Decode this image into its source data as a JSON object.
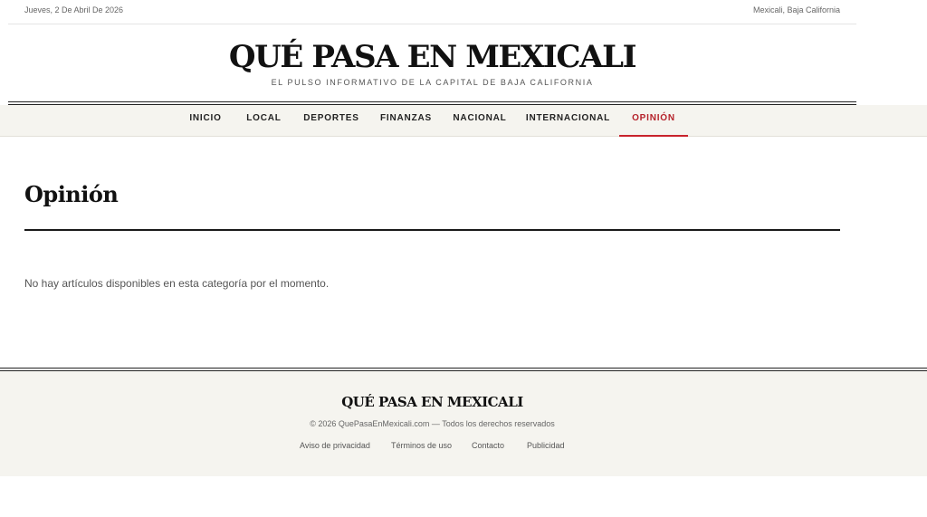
{
  "topbar": {
    "date": "Jueves, 2 De Abril De 2026",
    "location": "Mexicali, Baja California"
  },
  "masthead": {
    "title": "QUÉ PASA EN MEXICALI",
    "tagline": "EL PULSO INFORMATIVO DE LA CAPITAL DE BAJA CALIFORNIA"
  },
  "nav": {
    "items": [
      "INICIO",
      "LOCAL",
      "DEPORTES",
      "FINANZAS",
      "NACIONAL",
      "INTERNACIONAL",
      "OPINIÓN"
    ],
    "active": "OPINIÓN"
  },
  "main": {
    "heading": "Opinión",
    "empty_message": "No hay artículos disponibles en esta categoría por el momento."
  },
  "footer": {
    "title": "QUÉ PASA EN MEXICALI",
    "copyright": "© 2026 QuePasaEnMexicali.com — Todos los derechos reservados",
    "links": [
      "Aviso de privacidad",
      "Términos de uso",
      "Contacto",
      "Publicidad"
    ]
  },
  "colors": {
    "accent": "#c8232c",
    "nav_background": "#f5f4ef",
    "text": "#1a1a1a"
  }
}
